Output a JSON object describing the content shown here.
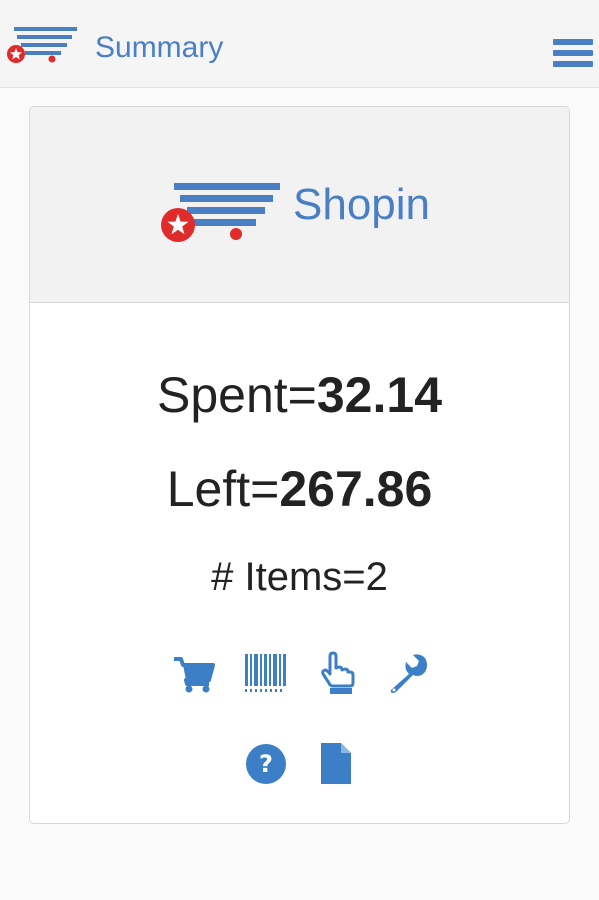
{
  "header": {
    "title": "Summary",
    "logo_icon": "shopping-cart-logo-icon",
    "menu_icon": "hamburger-menu-icon"
  },
  "brand": {
    "name": "Shopin"
  },
  "stats": {
    "spent_label": "Spent=",
    "spent_value": "32.14",
    "left_label": "Left=",
    "left_value": "267.86",
    "items_label": "# Items=",
    "items_value": "2"
  },
  "actions": [
    {
      "name": "cart",
      "icon": "cart-icon"
    },
    {
      "name": "barcode",
      "icon": "barcode-icon"
    },
    {
      "name": "touch",
      "icon": "hand-pointer-icon"
    },
    {
      "name": "settings",
      "icon": "wrench-icon"
    },
    {
      "name": "help",
      "icon": "question-circle-icon"
    },
    {
      "name": "document",
      "icon": "file-icon"
    }
  ],
  "colors": {
    "accent": "#4a7fc3",
    "logo_red": "#e02b2b",
    "text": "#222222"
  }
}
